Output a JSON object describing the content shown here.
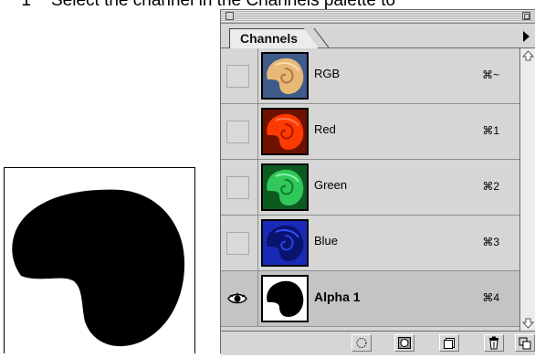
{
  "instruction": {
    "number": "1",
    "text": "Select the channel in the Channels palette to"
  },
  "palette": {
    "tab_label": "Channels",
    "channels": [
      {
        "name": "RGB",
        "shortcut": "⌘~",
        "visible": false,
        "selected": false,
        "thumb": "rgb"
      },
      {
        "name": "Red",
        "shortcut": "⌘1",
        "visible": false,
        "selected": false,
        "thumb": "red"
      },
      {
        "name": "Green",
        "shortcut": "⌘2",
        "visible": false,
        "selected": false,
        "thumb": "green"
      },
      {
        "name": "Blue",
        "shortcut": "⌘3",
        "visible": false,
        "selected": false,
        "thumb": "blue"
      },
      {
        "name": "Alpha 1",
        "shortcut": "⌘4",
        "visible": true,
        "selected": true,
        "thumb": "alpha"
      }
    ],
    "bottom_buttons": [
      "load-channel-selection-icon",
      "save-selection-channel-icon",
      "new-channel-icon",
      "trash-icon",
      "resize-grip-icon"
    ]
  },
  "colors": {
    "rgb_bg": "#3e5c8a",
    "red_bg": "#c61b00",
    "green_bg": "#1e9a3e",
    "blue_bg": "#1a2ab8",
    "alpha_bg": "#ffffff"
  }
}
